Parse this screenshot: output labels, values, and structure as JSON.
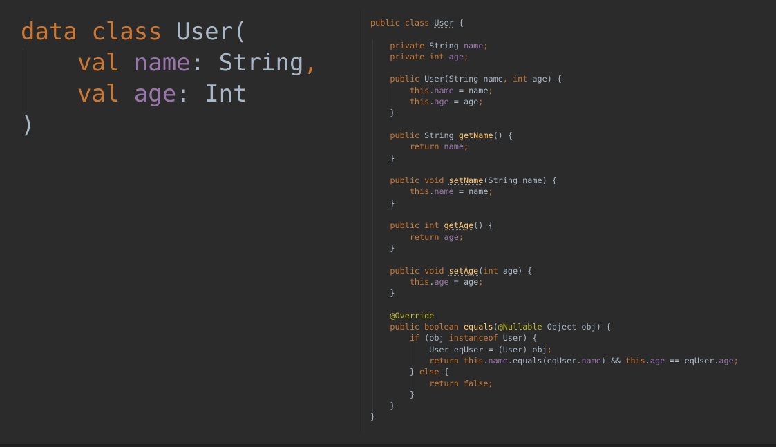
{
  "kotlin": {
    "lines": [
      [
        {
          "t": "data class ",
          "c": "kw"
        },
        {
          "t": "User(",
          "c": "plain"
        }
      ],
      [
        {
          "t": "    val ",
          "c": "kw"
        },
        {
          "t": "name",
          "c": "fld"
        },
        {
          "t": ": String",
          "c": "plain"
        },
        {
          "t": ",",
          "c": "kw"
        }
      ],
      [
        {
          "t": "    val ",
          "c": "kw"
        },
        {
          "t": "age",
          "c": "fld"
        },
        {
          "t": ": Int",
          "c": "plain"
        }
      ],
      [
        {
          "t": ")",
          "c": "plain"
        }
      ]
    ]
  },
  "java": {
    "lines": [
      [
        {
          "t": "public class ",
          "c": "kw"
        },
        {
          "t": "User",
          "c": "plain u"
        },
        {
          "t": " {",
          "c": "plain"
        }
      ],
      [],
      [
        {
          "t": "    private ",
          "c": "kw"
        },
        {
          "t": "String ",
          "c": "plain"
        },
        {
          "t": "name",
          "c": "fld"
        },
        {
          "t": ";",
          "c": "kw"
        }
      ],
      [
        {
          "t": "    private int ",
          "c": "kw"
        },
        {
          "t": "age",
          "c": "fld"
        },
        {
          "t": ";",
          "c": "kw"
        }
      ],
      [],
      [
        {
          "t": "    public ",
          "c": "kw"
        },
        {
          "t": "User",
          "c": "plain u"
        },
        {
          "t": "(String name",
          "c": "plain"
        },
        {
          "t": ", int ",
          "c": "kw"
        },
        {
          "t": "age) {",
          "c": "plain"
        }
      ],
      [
        {
          "t": "        this",
          "c": "kw"
        },
        {
          "t": ".",
          "c": "plain"
        },
        {
          "t": "name",
          "c": "fld"
        },
        {
          "t": " = name",
          "c": "plain"
        },
        {
          "t": ";",
          "c": "kw"
        }
      ],
      [
        {
          "t": "        this",
          "c": "kw"
        },
        {
          "t": ".",
          "c": "plain"
        },
        {
          "t": "age",
          "c": "fld"
        },
        {
          "t": " = age",
          "c": "plain"
        },
        {
          "t": ";",
          "c": "kw"
        }
      ],
      [
        {
          "t": "    }",
          "c": "plain"
        }
      ],
      [],
      [
        {
          "t": "    public ",
          "c": "kw"
        },
        {
          "t": "String ",
          "c": "plain"
        },
        {
          "t": "getName",
          "c": "fn u"
        },
        {
          "t": "() {",
          "c": "plain"
        }
      ],
      [
        {
          "t": "        return ",
          "c": "kw"
        },
        {
          "t": "name",
          "c": "fld"
        },
        {
          "t": ";",
          "c": "kw"
        }
      ],
      [
        {
          "t": "    }",
          "c": "plain"
        }
      ],
      [],
      [
        {
          "t": "    public void ",
          "c": "kw"
        },
        {
          "t": "setName",
          "c": "fn u"
        },
        {
          "t": "(String name) {",
          "c": "plain"
        }
      ],
      [
        {
          "t": "        this",
          "c": "kw"
        },
        {
          "t": ".",
          "c": "plain"
        },
        {
          "t": "name",
          "c": "fld"
        },
        {
          "t": " = name",
          "c": "plain"
        },
        {
          "t": ";",
          "c": "kw"
        }
      ],
      [
        {
          "t": "    }",
          "c": "plain"
        }
      ],
      [],
      [
        {
          "t": "    public int ",
          "c": "kw"
        },
        {
          "t": "getAge",
          "c": "fn u"
        },
        {
          "t": "() {",
          "c": "plain"
        }
      ],
      [
        {
          "t": "        return ",
          "c": "kw"
        },
        {
          "t": "age",
          "c": "fld"
        },
        {
          "t": ";",
          "c": "kw"
        }
      ],
      [
        {
          "t": "    }",
          "c": "plain"
        }
      ],
      [],
      [
        {
          "t": "    public void ",
          "c": "kw"
        },
        {
          "t": "setAge",
          "c": "fn u"
        },
        {
          "t": "(",
          "c": "plain"
        },
        {
          "t": "int ",
          "c": "kw"
        },
        {
          "t": "age) {",
          "c": "plain"
        }
      ],
      [
        {
          "t": "        this",
          "c": "kw"
        },
        {
          "t": ".",
          "c": "plain"
        },
        {
          "t": "age",
          "c": "fld"
        },
        {
          "t": " = age",
          "c": "plain"
        },
        {
          "t": ";",
          "c": "kw"
        }
      ],
      [
        {
          "t": "    }",
          "c": "plain"
        }
      ],
      [],
      [
        {
          "t": "    @Override",
          "c": "ann"
        }
      ],
      [
        {
          "t": "    public boolean ",
          "c": "kw"
        },
        {
          "t": "equals",
          "c": "fn"
        },
        {
          "t": "(",
          "c": "plain"
        },
        {
          "t": "@Nullable",
          "c": "ann"
        },
        {
          "t": " Object obj) {",
          "c": "plain"
        }
      ],
      [
        {
          "t": "        if ",
          "c": "kw"
        },
        {
          "t": "(obj ",
          "c": "plain"
        },
        {
          "t": "instanceof ",
          "c": "kw"
        },
        {
          "t": "User) {",
          "c": "plain"
        }
      ],
      [
        {
          "t": "            User eqUser = (User) obj",
          "c": "plain"
        },
        {
          "t": ";",
          "c": "kw"
        }
      ],
      [
        {
          "t": "            return this",
          "c": "kw"
        },
        {
          "t": ".",
          "c": "plain"
        },
        {
          "t": "name",
          "c": "fld"
        },
        {
          "t": ".equals(eqUser.",
          "c": "plain"
        },
        {
          "t": "name",
          "c": "fld"
        },
        {
          "t": ") && ",
          "c": "plain"
        },
        {
          "t": "this",
          "c": "kw"
        },
        {
          "t": ".",
          "c": "plain"
        },
        {
          "t": "age",
          "c": "fld"
        },
        {
          "t": " == eqUser.",
          "c": "plain"
        },
        {
          "t": "age",
          "c": "fld"
        },
        {
          "t": ";",
          "c": "kw"
        }
      ],
      [
        {
          "t": "        } ",
          "c": "plain"
        },
        {
          "t": "else ",
          "c": "kw"
        },
        {
          "t": "{",
          "c": "plain"
        }
      ],
      [
        {
          "t": "            return false;",
          "c": "kw"
        }
      ],
      [
        {
          "t": "        }",
          "c": "plain"
        }
      ],
      [
        {
          "t": "    }",
          "c": "plain"
        }
      ],
      [
        {
          "t": "}",
          "c": "plain"
        }
      ]
    ]
  },
  "colors": {
    "background": "#2b2b2b",
    "keyword": "#cc7832",
    "field": "#9876aa",
    "function": "#ffc66d",
    "annotation": "#bbb529",
    "plain": "#a9b7c6"
  }
}
